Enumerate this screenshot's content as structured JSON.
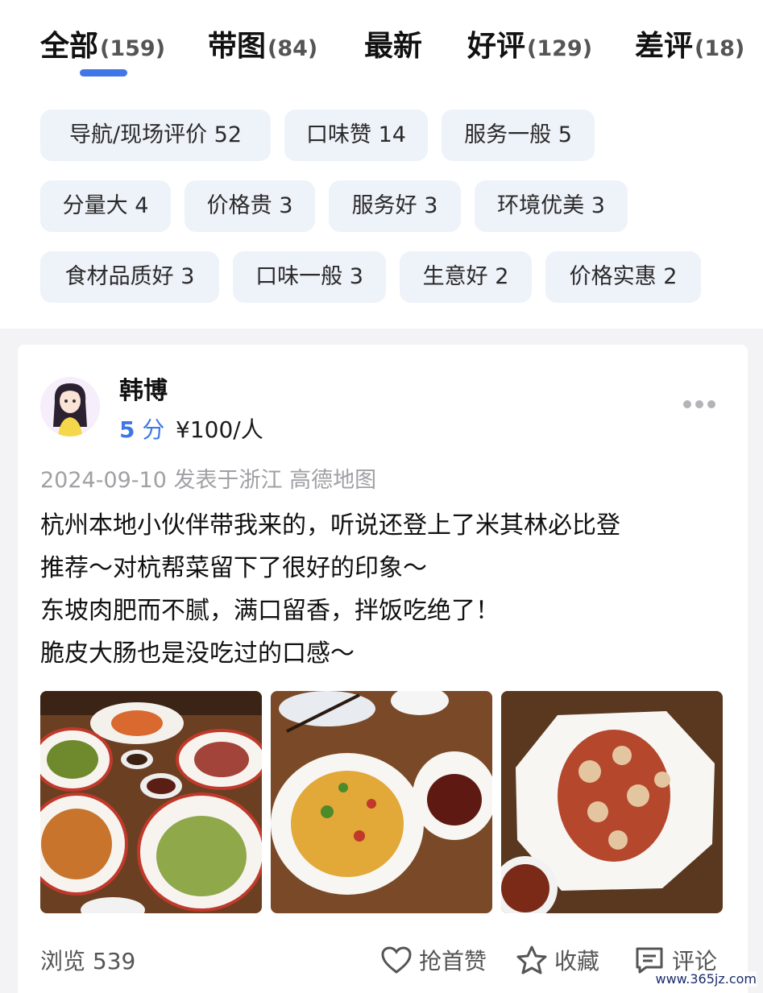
{
  "tabs": [
    {
      "label": "全部",
      "count": "(159)"
    },
    {
      "label": "带图",
      "count": "(84)"
    },
    {
      "label": "最新",
      "count": ""
    },
    {
      "label": "好评",
      "count": "(129)"
    },
    {
      "label": "差评",
      "count": "(18)"
    }
  ],
  "tags": [
    "导航/现场评价 52",
    "口味赞 14",
    "服务一般 5",
    "分量大 4",
    "价格贵 3",
    "服务好 3",
    "环境优美 3",
    "食材品质好 3",
    "口味一般 3",
    "生意好 2",
    "价格实惠 2"
  ],
  "review": {
    "username": "韩博",
    "score": "5",
    "score_unit": "分",
    "price": "¥100/人",
    "meta": "2024-09-10 发表于浙江  高德地图",
    "lines": [
      "杭州本地小伙伴带我来的，听说还登上了米其林必比登",
      "推荐～对杭帮菜留下了很好的印象～",
      "东坡肉肥而不腻，满口留香，拌饭吃绝了！",
      "脆皮大肠也是没吃过的口感～"
    ],
    "views": "浏览 539",
    "like_label": "抢首赞",
    "fav_label": "收藏",
    "comment_label": "评论"
  },
  "watermark": "www.365jz.com",
  "colors": {
    "accent": "#3f78e6",
    "chip_bg": "#eef2f9",
    "page_bg": "#f3f3f5"
  }
}
